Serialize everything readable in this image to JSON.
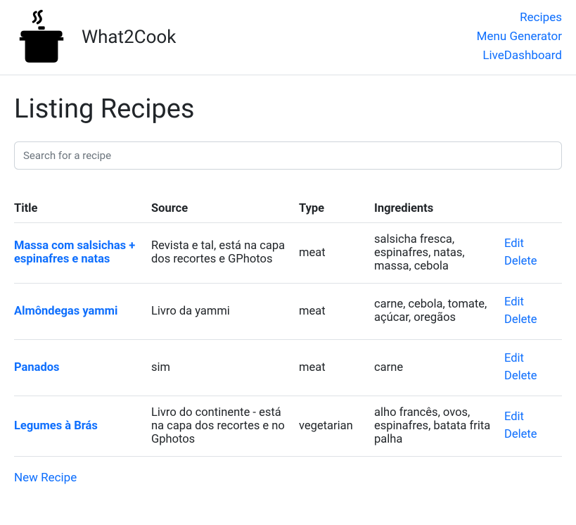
{
  "header": {
    "brand_title": "What2Cook",
    "nav": {
      "recipes": "Recipes",
      "menu_generator": "Menu Generator",
      "live_dashboard": "LiveDashboard"
    }
  },
  "page": {
    "heading": "Listing Recipes",
    "search_placeholder": "Search for a recipe",
    "new_recipe_label": "New Recipe"
  },
  "table": {
    "headers": {
      "title": "Title",
      "source": "Source",
      "type": "Type",
      "ingredients": "Ingredients"
    },
    "actions": {
      "edit": "Edit",
      "delete": "Delete"
    },
    "rows": [
      {
        "title": "Massa com salsichas + espinafres e natas",
        "source": "Revista e tal, está na capa dos recortes e GPhotos",
        "type": "meat",
        "ingredients": "salsicha fresca, espinafres, natas, massa, cebola"
      },
      {
        "title": "Almôndegas yammi",
        "source": "Livro da yammi",
        "type": "meat",
        "ingredients": "carne, cebola, tomate, açúcar, oregãos"
      },
      {
        "title": "Panados",
        "source": "sim",
        "type": "meat",
        "ingredients": "carne"
      },
      {
        "title": "Legumes à Brás",
        "source": "Livro do continente - está na capa dos recortes e no Gphotos",
        "type": "vegetarian",
        "ingredients": "alho francês, ovos, espinafres, batata frita palha"
      }
    ]
  }
}
